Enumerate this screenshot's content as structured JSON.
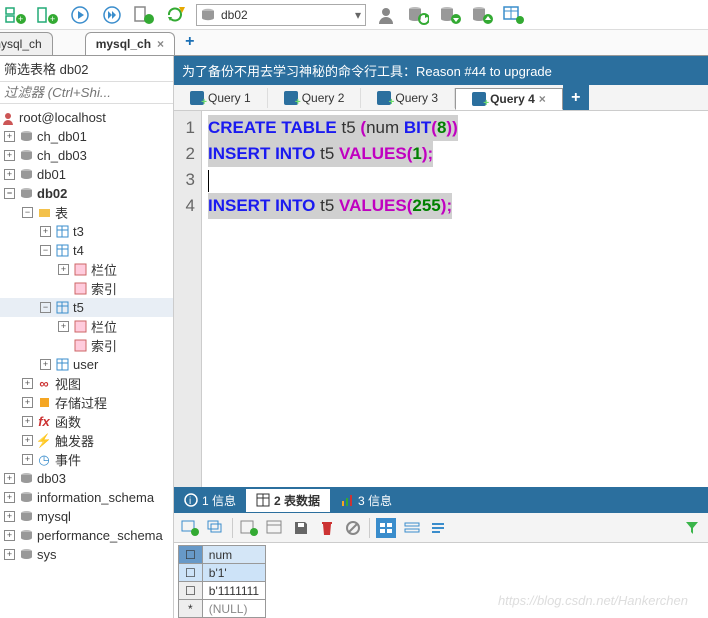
{
  "toolbar": {
    "db_selected": "db02"
  },
  "file_tabs": {
    "left": "mysql_ch",
    "active": "mysql_ch"
  },
  "sidebar": {
    "filter_label": "筛选表格 db02",
    "filter_placeholder": "过滤器 (Ctrl+Shi...",
    "root": "root@localhost",
    "dbs": [
      "ch_db01",
      "ch_db03",
      "db01",
      "db02"
    ],
    "tables_label": "表",
    "tables": [
      "t3",
      "t4",
      "t5",
      "user"
    ],
    "child_cols": "栏位",
    "child_idx": "索引",
    "views": "视图",
    "procs": "存储过程",
    "funcs": "函数",
    "triggers": "触发器",
    "events": "事件",
    "other_dbs": [
      "db03",
      "information_schema",
      "mysql",
      "performance_schema",
      "sys"
    ]
  },
  "upgrade_bar": "为了备份不用去学习神秘的命令行工具：Reason #44 to upgrade",
  "query_tabs": [
    "Query 1",
    "Query 2",
    "Query 3",
    "Query 4"
  ],
  "code": {
    "line1": {
      "t1": "CREATE",
      "t2": "TABLE",
      "t3": " t5 ",
      "t4": "(",
      "t5": "num ",
      "t6": "BIT",
      "t7": "(",
      "t8": "8",
      "t9": ")",
      "t10": ")"
    },
    "line2": {
      "t1": "INSERT",
      "t2": "INTO",
      "t3": " t5 ",
      "t4": "VALUES",
      "t5": "(",
      "t6": "1",
      "t7": ")",
      "t8": ";"
    },
    "line4": {
      "t1": "INSERT",
      "t2": "INTO",
      "t3": " t5 ",
      "t4": "VALUES",
      "t5": "(",
      "t6": "255",
      "t7": ")",
      "t8": ";"
    }
  },
  "result_tabs": {
    "t1": "1 信息",
    "t2": "2 表数据",
    "t3": "3 信息"
  },
  "grid": {
    "col": "num",
    "rows": [
      "b'1'",
      "b'1111111"
    ],
    "null_marker": "*",
    "null_text": "(NULL)"
  },
  "watermark": "https://blog.csdn.net/Hankerchen"
}
